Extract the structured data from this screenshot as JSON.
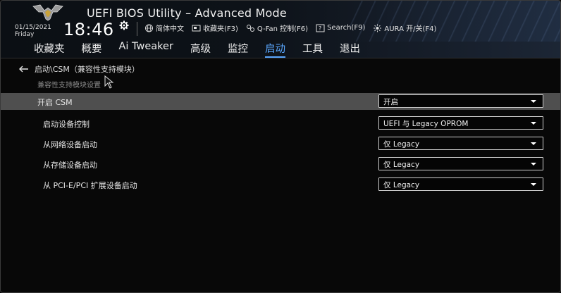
{
  "header": {
    "title": "UEFI BIOS Utility – Advanced Mode",
    "date": "01/15/2021",
    "weekday": "Friday",
    "time": "18:46"
  },
  "toolbar": [
    {
      "label": "简体中文",
      "icon": "globe-icon"
    },
    {
      "label": "收藏夹(F3)",
      "icon": "favorites-icon"
    },
    {
      "label": "Q-Fan 控制(F6)",
      "icon": "fan-icon"
    },
    {
      "label": "Search(F9)",
      "icon": "search-icon"
    },
    {
      "label": "AURA 开/关(F4)",
      "icon": "aura-icon"
    }
  ],
  "tabs": [
    {
      "label": "收藏夹",
      "active": false
    },
    {
      "label": "概要",
      "active": false
    },
    {
      "label": "Ai Tweaker",
      "active": false
    },
    {
      "label": "高级",
      "active": false
    },
    {
      "label": "监控",
      "active": false
    },
    {
      "label": "启动",
      "active": true
    },
    {
      "label": "工具",
      "active": false
    },
    {
      "label": "退出",
      "active": false
    }
  ],
  "breadcrumb": "启动\\CSM（兼容性支持模块）",
  "subtitle": "兼容性支持模块设置",
  "settings": [
    {
      "label": "开启 CSM",
      "value": "开启",
      "selected": true
    },
    {
      "label": "启动设备控制",
      "value": "UEFI 与 Legacy OPROM",
      "selected": false
    },
    {
      "label": "从网络设备启动",
      "value": "仅 Legacy",
      "selected": false
    },
    {
      "label": "从存储设备启动",
      "value": "仅 Legacy",
      "selected": false
    },
    {
      "label": "从 PCI-E/PCI 扩展设备启动",
      "value": "仅 Legacy",
      "selected": false
    }
  ],
  "colors": {
    "active_tab": "#5aa7ff",
    "selected_row": "#4f4f4f",
    "background": "#080808"
  }
}
